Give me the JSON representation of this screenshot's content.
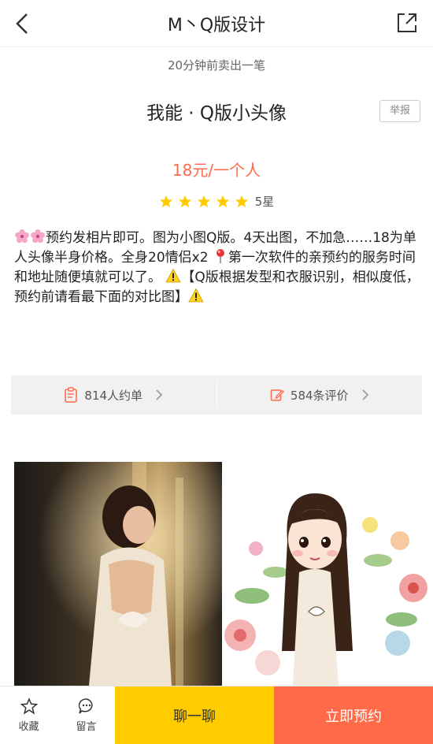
{
  "nav": {
    "title": "M丶Q版设计"
  },
  "recent_sale": "20分钟前卖出一笔",
  "headline": "我能 · Q版小头像",
  "report_label": "举报",
  "price": "18元/一个人",
  "rating": {
    "stars": 5,
    "label": "5星"
  },
  "description": {
    "part1": "预约发相片即可。图为小图Q版。4天出图，不加急……18为单人头像半身价格。全身20情侣x2",
    "part2": "第一次软件的亲预约的服务时间和地址随便填就可以了。",
    "part3": "【Q版根据发型和衣服识别，相似度低，预约前请看最下面的对比图】"
  },
  "stats": {
    "orders": "814人约单",
    "reviews": "584条评价"
  },
  "bottom": {
    "favorite": "收藏",
    "message": "留言",
    "chat": "聊一聊",
    "book": "立即预约"
  },
  "colors": {
    "accent": "#ff6a48",
    "star": "#ffcc00",
    "chat_button": "#ffcc00",
    "book_button": "#ff6a48"
  }
}
